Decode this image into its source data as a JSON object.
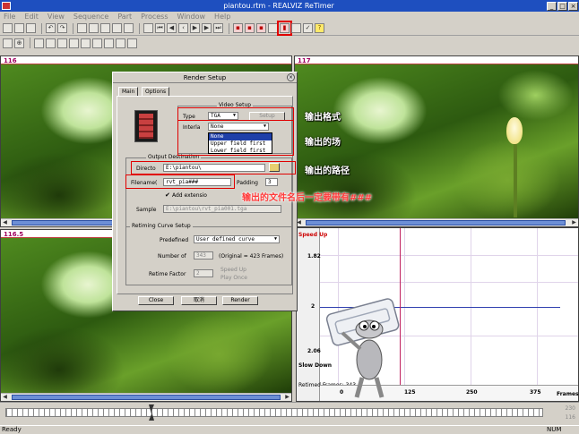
{
  "window": {
    "title": "piantou.rtm - REALVIZ ReTimer",
    "min": "_",
    "max": "□",
    "close": "×"
  },
  "menu": [
    "File",
    "Edit",
    "View",
    "Sequence",
    "Part",
    "Process",
    "Window",
    "Help"
  ],
  "panes": {
    "top_left_frame": "116",
    "top_right_frame": "117",
    "bottom_left_frame": "116.5"
  },
  "curve": {
    "speed_up": "Speed Up",
    "slow_down": "Slow Down",
    "y_ticks": [
      "1.82",
      "2",
      "2.06"
    ],
    "x_ticks": [
      "0",
      "125",
      "250",
      "375"
    ],
    "x_label": "Frames",
    "retimed_label": "Retimed Frames: 343"
  },
  "timeline": {
    "top_value": "230",
    "bottom_value": "116"
  },
  "status": {
    "left": "Ready",
    "right": "NUM"
  },
  "dialog": {
    "title": "Render Setup",
    "close": "×",
    "tabs": [
      "Main",
      "Options"
    ],
    "video_setup": "Video Setup",
    "type_label": "Type",
    "type_value": "TGA",
    "setup_button": "Setup",
    "interlace_label": "Interla",
    "interlace_value": "None",
    "interlace_options": [
      "None",
      "Upper field first",
      "Lower field first"
    ],
    "output_destination": "Output Destination",
    "directory_label": "Directo",
    "directory_value": "E:\\piantou\\",
    "filename_label": "Filename(",
    "filename_value": "rvt_pia###",
    "padding_label": "Padding",
    "padding_value": "3",
    "add_extension": "Add extensio",
    "sample_label": "Sample",
    "sample_value": "E:\\piantou\\rvt_pia001.tga",
    "retiming_curve_setup": "Retiming Curve Setup",
    "predefined_label": "Predefined",
    "predefined_value": "User defined curve",
    "number_of_label": "Number of",
    "number_of_value": "343",
    "original_frames": "(Original = 423 Frames)",
    "retime_factor_label": "Retime Factor",
    "retime_factor_value": "2",
    "speed_up": "Speed Up",
    "play_once": "Play Once",
    "close_button": "Close",
    "cancel_button": "取消",
    "render_button": "Render"
  },
  "annotations": {
    "output_format": "输出格式",
    "output_field": "输出的场",
    "output_path": "输出的路径",
    "filename_note": "输出的文件名后一定要带有###"
  },
  "colors": {
    "titlebar": "#1e4fbf",
    "annotation_red": "#e00000",
    "selection": "#1f3fa8"
  }
}
